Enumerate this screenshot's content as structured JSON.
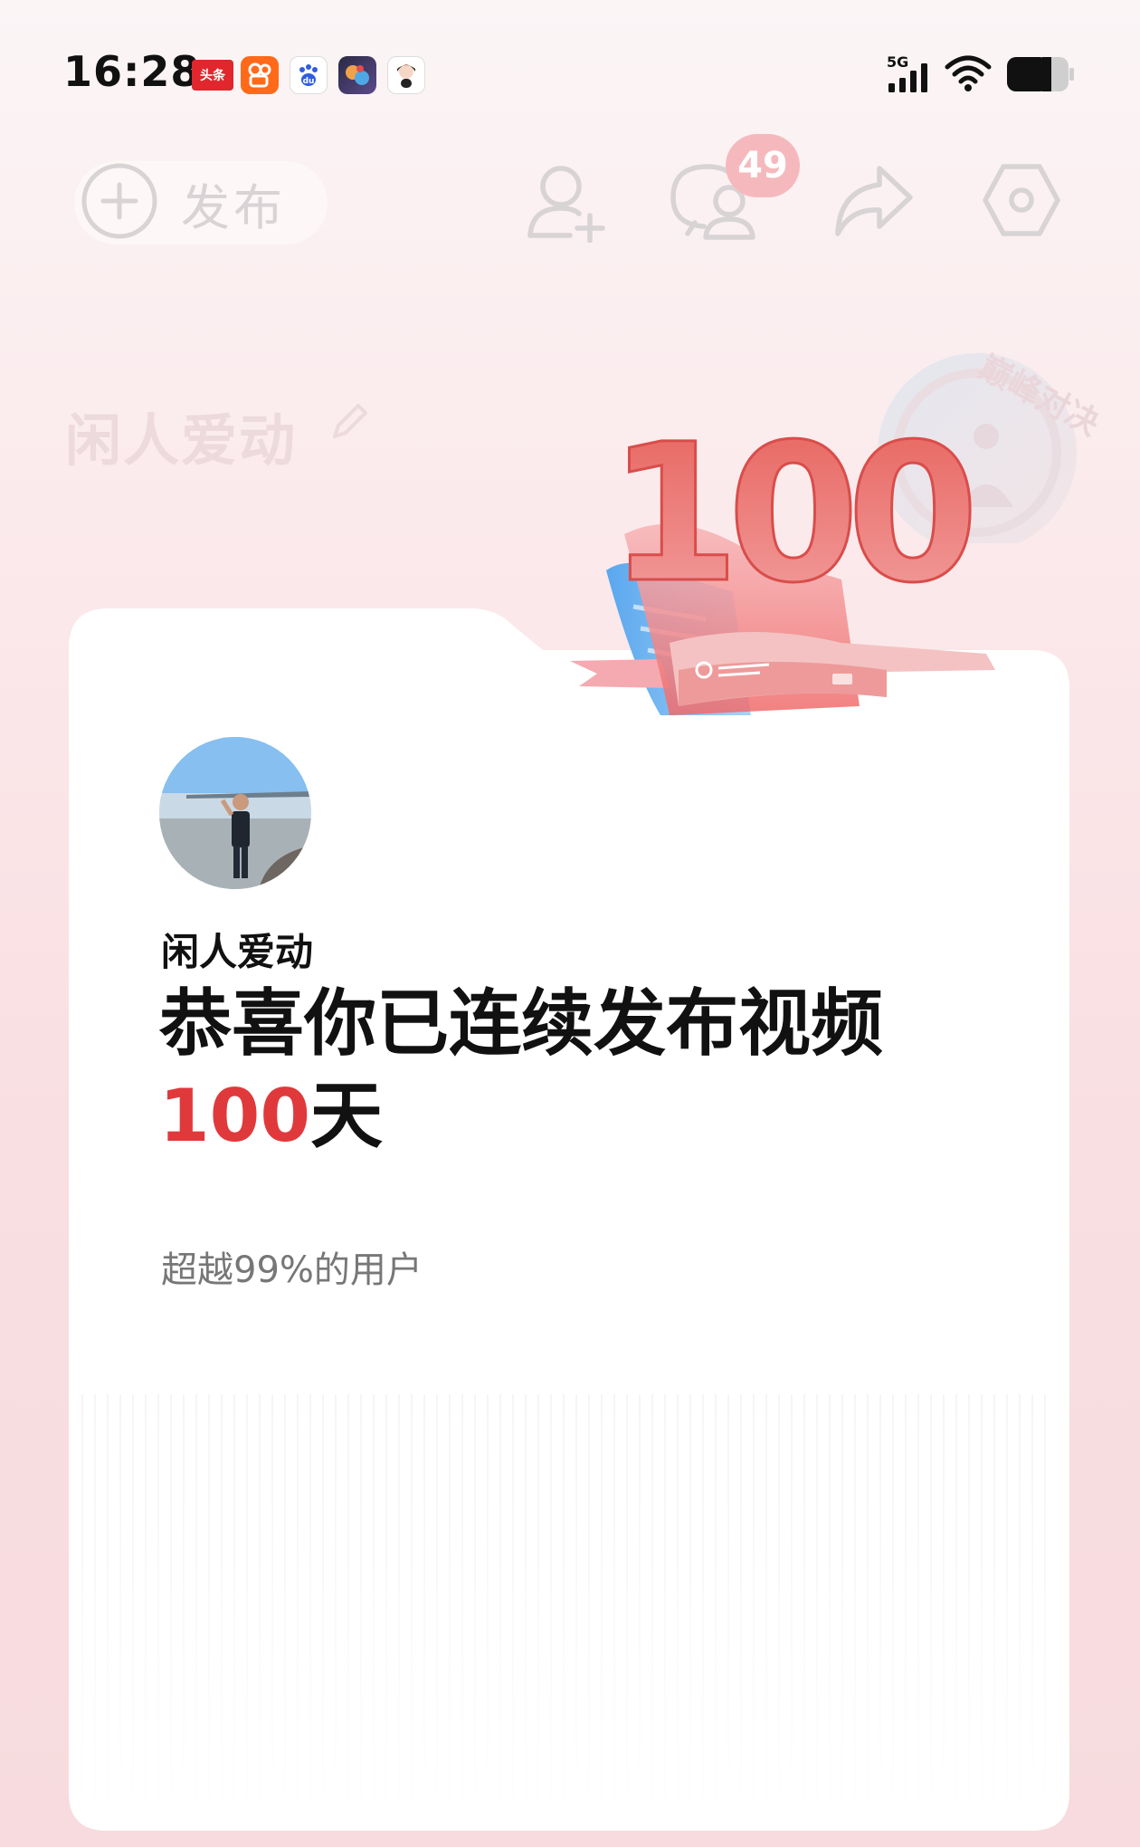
{
  "status_bar": {
    "time": "16:28",
    "apps": [
      {
        "name": "toutiao",
        "label": "头条",
        "color": "#e1262d"
      },
      {
        "name": "kuaishou",
        "label": "",
        "color": "#ff6a1a"
      },
      {
        "name": "baidu",
        "label": "du",
        "color": "#ffffff"
      },
      {
        "name": "game",
        "label": "",
        "color": "#3d3a5c"
      },
      {
        "name": "avatar-app",
        "label": "",
        "color": "#ffffff"
      }
    ],
    "network": "5G"
  },
  "toolbar": {
    "publish_label": "发布",
    "message_count": "49",
    "icons": [
      "add-friend-icon",
      "messages-icon",
      "share-icon",
      "settings-icon"
    ]
  },
  "profile": {
    "name": "闲人爱动"
  },
  "card": {
    "hero_number": "100",
    "username": "闲人爱动",
    "headline_text": "恭喜你已连续发布视频",
    "days_number": "100",
    "days_unit": "天",
    "subtitle": "超越99%的用户",
    "emblem_text": "巅峰对决"
  },
  "colors": {
    "accent_red": "#e0393c",
    "hero_red": "#e86660",
    "page_bg": "#f9e3e6"
  }
}
